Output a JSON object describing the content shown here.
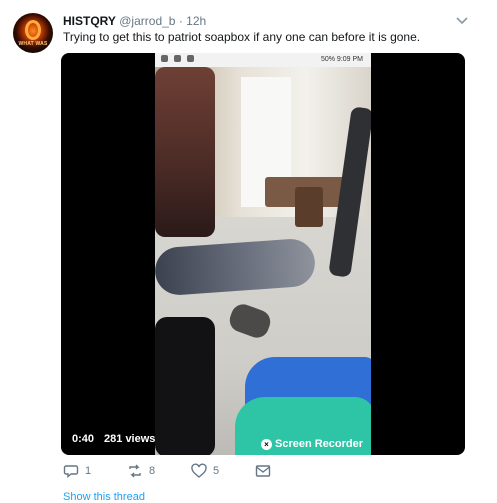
{
  "tweet": {
    "avatar_text": "WHAT WAS",
    "display_name": "HISTQRY",
    "handle": "@jarrod_b",
    "separator": "·",
    "time": "12h",
    "text": "Trying to get this to patriot soapbox if any one can before it is gone."
  },
  "media": {
    "phone_status": "50% 9:09 PM",
    "duration": "0:40",
    "views": "281 views",
    "watermark": "Screen Recorder"
  },
  "actions": {
    "reply_count": "1",
    "retweet_count": "8",
    "like_count": "5"
  },
  "thread_link": "Show this thread",
  "colors": {
    "text": "#14171a",
    "secondary": "#657786",
    "link": "#1da1f2",
    "media_bg": "#000000"
  },
  "icons": [
    "chevron-down-icon",
    "reply-icon",
    "retweet-icon",
    "like-icon",
    "message-icon",
    "screen-recorder-icon"
  ]
}
